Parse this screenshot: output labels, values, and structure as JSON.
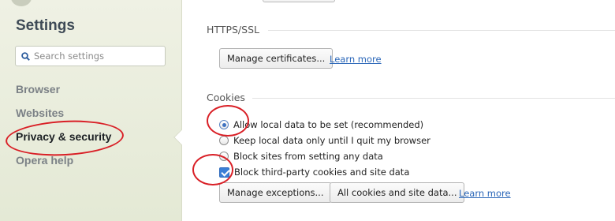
{
  "sidebar": {
    "title": "Settings",
    "search": {
      "placeholder": "Search settings",
      "value": ""
    },
    "items": [
      {
        "label": "Browser",
        "active": false
      },
      {
        "label": "Websites",
        "active": false
      },
      {
        "label": "Privacy & security",
        "active": true
      },
      {
        "label": "Opera help",
        "active": false
      }
    ]
  },
  "https_ssl": {
    "title": "HTTPS/SSL",
    "manage_certificates_label": "Manage certificates...",
    "learn_more_label": "Learn more"
  },
  "cookies": {
    "title": "Cookies",
    "options": [
      {
        "label": "Allow local data to be set (recommended)",
        "type": "radio",
        "checked": true
      },
      {
        "label": "Keep local data only until I quit my browser",
        "type": "radio",
        "checked": false
      },
      {
        "label": "Block sites from setting any data",
        "type": "radio",
        "checked": false
      },
      {
        "label": "Block third-party cookies and site data",
        "type": "checkbox",
        "checked": true
      }
    ],
    "manage_exceptions_label": "Manage exceptions...",
    "all_cookies_label": "All cookies and site data...",
    "learn_more_label": "Learn more"
  },
  "colors": {
    "annotation": "#d91f26",
    "link": "#2a66b8",
    "accent": "#3b7fd6"
  }
}
